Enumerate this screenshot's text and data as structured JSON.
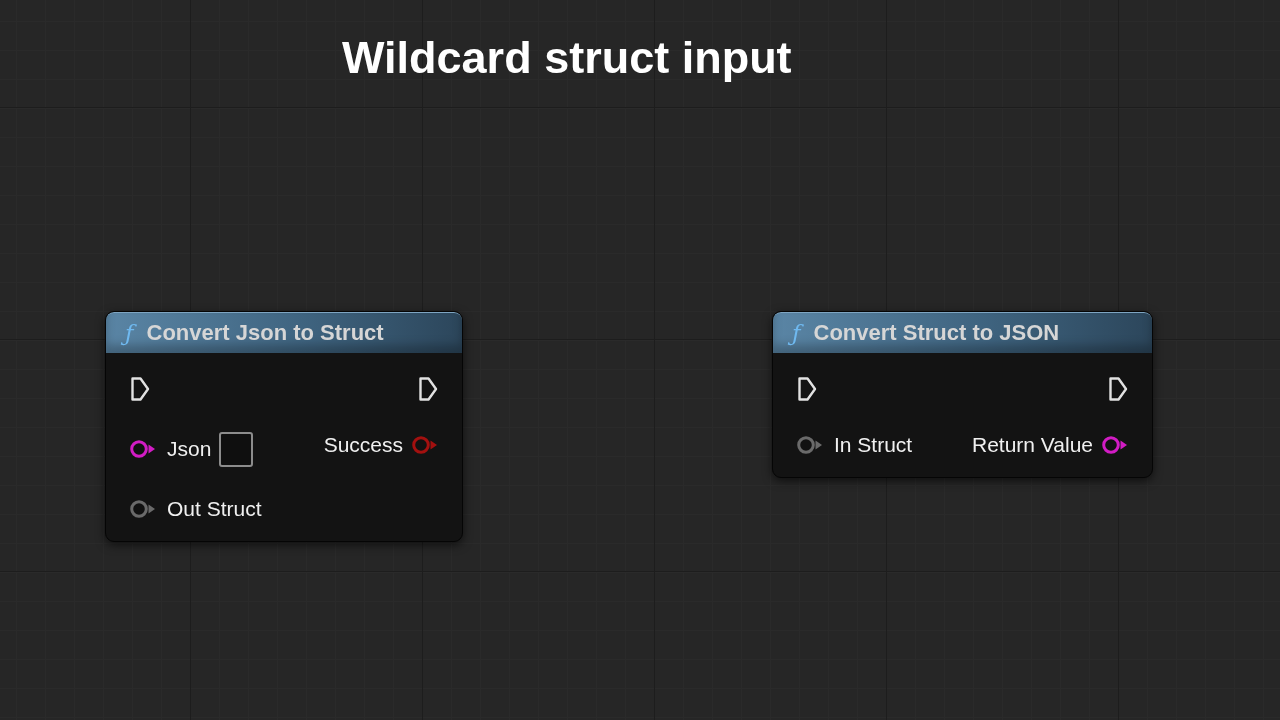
{
  "title": "Wildcard struct input",
  "nodes": [
    {
      "icon_glyph": "ƒ",
      "title": "Convert Json to Struct",
      "inputs": [
        {
          "label": "Json",
          "color": "#d21cc4",
          "connected": false,
          "has_input_box": true
        },
        {
          "label": "Out Struct",
          "color": "#6a6a6a",
          "connected": false,
          "has_input_box": false
        }
      ],
      "outputs": [
        {
          "label": "Success",
          "color": "#a3100f",
          "connected": false
        }
      ]
    },
    {
      "icon_glyph": "ƒ",
      "title": "Convert Struct to JSON",
      "inputs": [
        {
          "label": "In Struct",
          "color": "#6a6a6a",
          "connected": false,
          "has_input_box": false
        }
      ],
      "outputs": [
        {
          "label": "Return Value",
          "color": "#d21cc4",
          "connected": false
        }
      ]
    }
  ]
}
